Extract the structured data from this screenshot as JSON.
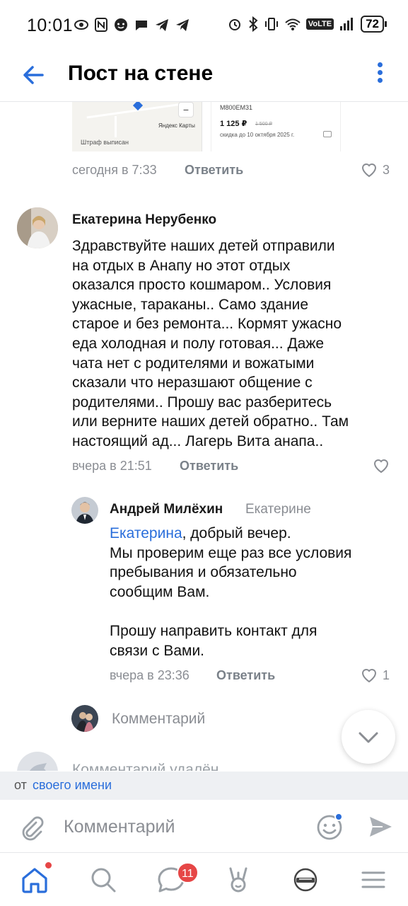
{
  "status_bar": {
    "time": "10:01",
    "network": "VoLTE",
    "battery": "72"
  },
  "header": {
    "title": "Пост на стене"
  },
  "top_attachment": {
    "map_brand": "Яндекс Карты",
    "map_caption": "Штраф выписан",
    "plate": "М800ЕМ31",
    "price": "1 125 ₽",
    "old_price": "1 500 ₽",
    "discount": "скидка до 10 октября 2025 г."
  },
  "post_footer": {
    "time": "сегодня в 7:33",
    "reply_label": "Ответить",
    "likes": "3"
  },
  "comments": [
    {
      "author": "Екатерина Нерубенко",
      "lines": [
        "Здравствуйте наших детей отправили",
        "на отдых в Анапу но этот отдых",
        "оказался просто кошмаром.. Условия",
        "ужасные, тараканы.. Само здание",
        "старое и без ремонта... Кормят ужасно",
        "еда  холодная и полу готовая... Даже",
        "чата нет с родителями и вожатыми",
        "сказали что неразшают общение с",
        "родителями.. Прошу вас разберитесь",
        "или верните наших детей обратно.. Там",
        "настоящий ад... Лагерь Вита анапа.."
      ],
      "time": "вчера в 21:51",
      "reply_label": "Ответить"
    },
    {
      "author": "Андрей Милёхин",
      "reply_to": "Екатерине",
      "mention": "Екатерина",
      "lines": [
        ", добрый вечер.",
        "Мы проверим еще раз все условия",
        "пребывания и обязательно",
        "сообщим Вам.",
        "",
        "Прошу направить контакт для",
        "связи с Вами."
      ],
      "time": "вчера в 23:36",
      "reply_label": "Ответить",
      "likes": "1"
    }
  ],
  "inline_reply": {
    "placeholder": "Комментарий"
  },
  "deleted": {
    "text": "Комментарий удалён"
  },
  "from_bar": {
    "prefix": "от",
    "link": "своего имени"
  },
  "composer": {
    "placeholder": "Комментарий"
  },
  "bottom_nav": {
    "items": [
      "home-icon",
      "search-icon",
      "messages-icon",
      "clips-icon",
      "vk-video-icon",
      "menu-icon"
    ],
    "messages_badge": "11"
  },
  "colors": {
    "accent": "#2a6edb",
    "badge": "#e64646",
    "muted_text": "#8a8d93"
  }
}
